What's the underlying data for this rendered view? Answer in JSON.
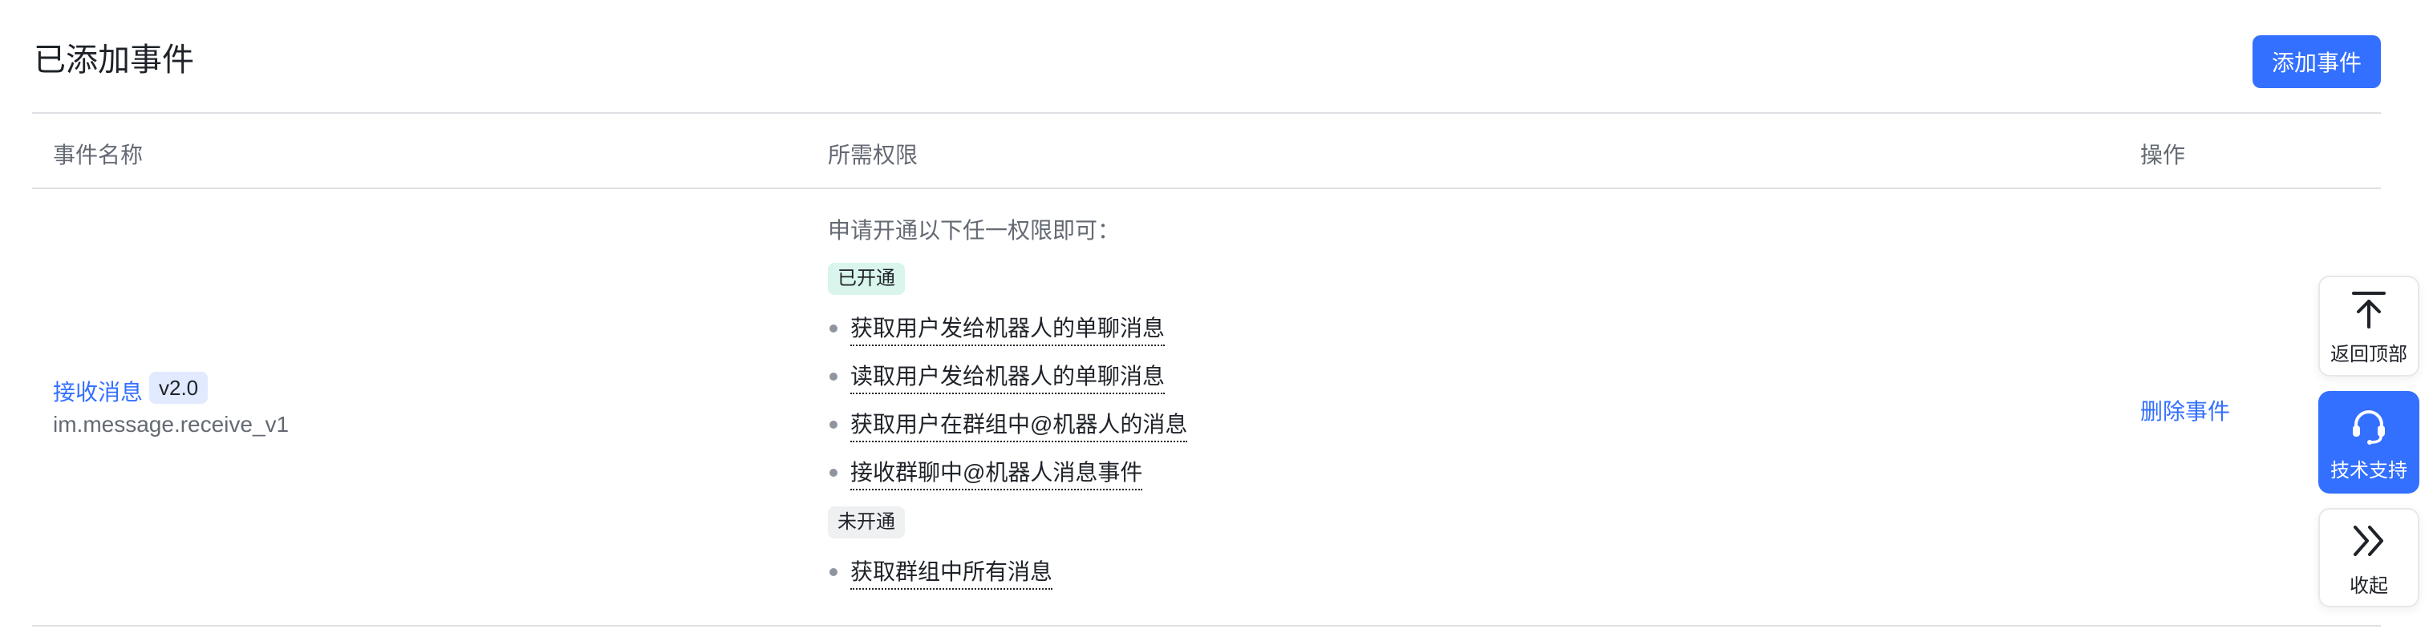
{
  "header": {
    "title": "已添加事件",
    "add_button": "添加事件"
  },
  "table": {
    "columns": [
      "事件名称",
      "所需权限",
      "操作"
    ],
    "rows": [
      {
        "event_name": "接收消息",
        "version": "v2.0",
        "event_key": "im.message.receive_v1",
        "permission_intro": "申请开通以下任一权限即可：",
        "enabled_tag": "已开通",
        "enabled_permissions": [
          "获取用户发给机器人的单聊消息",
          "读取用户发给机器人的单聊消息",
          "获取用户在群组中@机器人的消息",
          "接收群聊中@机器人消息事件"
        ],
        "disabled_tag": "未开通",
        "disabled_permissions": [
          "获取群组中所有消息"
        ],
        "action": "删除事件"
      }
    ]
  },
  "float_toolbar": {
    "back_to_top": "返回顶部",
    "support": "技术支持",
    "collapse": "收起",
    "accent_color": "#3370ff"
  }
}
